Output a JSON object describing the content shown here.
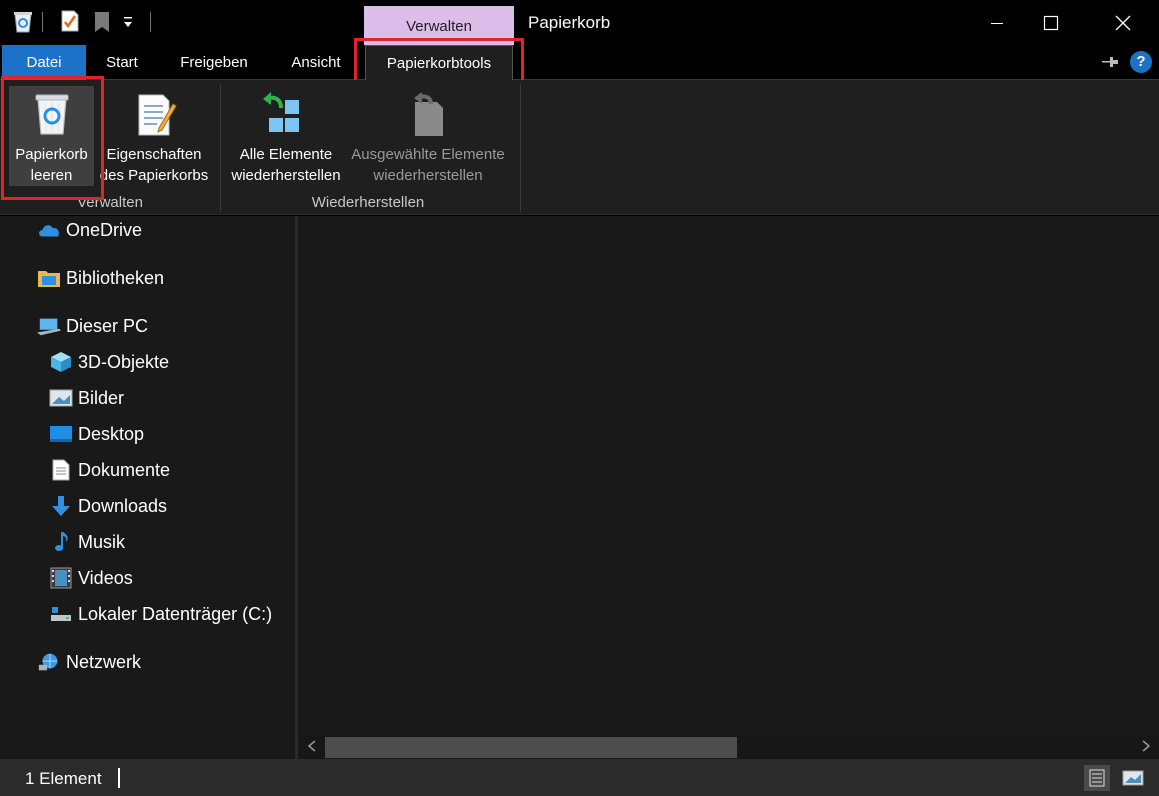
{
  "window": {
    "title": "Papierkorb",
    "context_group": "Verwalten",
    "minimize_glyph": "─",
    "maximize_glyph": "☐",
    "close_glyph": "✕"
  },
  "tabs": [
    {
      "label": "Datei"
    },
    {
      "label": "Start"
    },
    {
      "label": "Freigeben"
    },
    {
      "label": "Ansicht"
    },
    {
      "label": "Papierkorbtools"
    }
  ],
  "ribbon": {
    "groups": [
      {
        "label": "Verwalten"
      },
      {
        "label": "Wiederherstellen"
      }
    ],
    "buttons": [
      {
        "label": "Papierkorb\nleeren",
        "icon": "recycle-bin-icon"
      },
      {
        "label": "Eigenschaften\ndes Papierkorbs",
        "icon": "properties-icon"
      },
      {
        "label": "Alle Elemente\nwiederherstellen",
        "icon": "restore-all-icon"
      },
      {
        "label": "Ausgewählte Elemente\nwiederherstellen",
        "icon": "restore-selected-icon"
      }
    ]
  },
  "nav": {
    "items": [
      {
        "label": "OneDrive",
        "icon": "cloud-icon"
      },
      {
        "label": "Bibliotheken",
        "icon": "libraries-folder-icon"
      },
      {
        "label": "Dieser PC",
        "icon": "computer-icon"
      },
      {
        "label": "3D-Objekte",
        "icon": "cube-icon"
      },
      {
        "label": "Bilder",
        "icon": "pictures-icon"
      },
      {
        "label": "Desktop",
        "icon": "desktop-icon"
      },
      {
        "label": "Dokumente",
        "icon": "document-icon"
      },
      {
        "label": "Downloads",
        "icon": "download-arrow-icon"
      },
      {
        "label": "Musik",
        "icon": "music-note-icon"
      },
      {
        "label": "Videos",
        "icon": "film-icon"
      },
      {
        "label": "Lokaler Datenträger (C:)",
        "icon": "drive-icon"
      },
      {
        "label": "Netzwerk",
        "icon": "network-icon"
      }
    ]
  },
  "status": {
    "count_text": "1 Element"
  },
  "colors": {
    "file_tab": "#1c72c7",
    "context_group": "#dcbde9",
    "highlight_box": "#e0242b",
    "help_button": "#1c72c7"
  }
}
